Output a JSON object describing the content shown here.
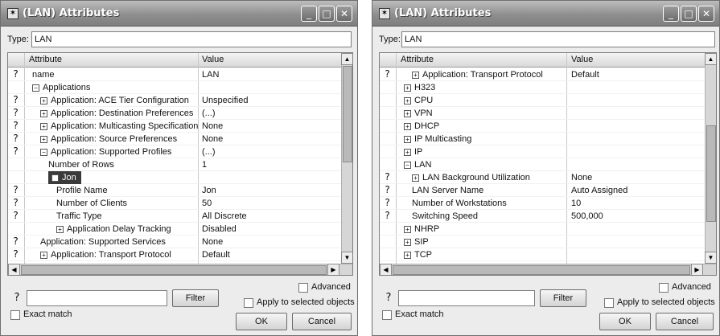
{
  "left": {
    "title": "(LAN) Attributes",
    "type_label": "Type:",
    "type_value": "LAN",
    "columns": {
      "attribute": "Attribute",
      "value": "Value"
    },
    "rows": [
      {
        "help": true,
        "indent": 1,
        "toggle": "",
        "label": "name",
        "value": "LAN"
      },
      {
        "help": false,
        "indent": 1,
        "toggle": "−",
        "label": "Applications",
        "value": ""
      },
      {
        "help": true,
        "indent": 2,
        "toggle": "+",
        "label": "Application: ACE Tier Configuration",
        "value": "Unspecified"
      },
      {
        "help": true,
        "indent": 2,
        "toggle": "+",
        "label": "Application: Destination Preferences",
        "value": "(...)"
      },
      {
        "help": true,
        "indent": 2,
        "toggle": "+",
        "label": "Application: Multicasting Specification",
        "value": "None"
      },
      {
        "help": true,
        "indent": 2,
        "toggle": "+",
        "label": "Application: Source Preferences",
        "value": "None"
      },
      {
        "help": true,
        "indent": 2,
        "toggle": "−",
        "label": "Application: Supported Profiles",
        "value": "(...)"
      },
      {
        "help": false,
        "indent": 3,
        "toggle": "",
        "label": "Number of Rows",
        "value": "1"
      },
      {
        "help": false,
        "indent": 3,
        "toggle": "−",
        "label": "Jon",
        "value": "",
        "selected": true
      },
      {
        "help": true,
        "indent": 4,
        "toggle": "",
        "label": "Profile Name",
        "value": "Jon"
      },
      {
        "help": true,
        "indent": 4,
        "toggle": "",
        "label": "Number of Clients",
        "value": "50"
      },
      {
        "help": true,
        "indent": 4,
        "toggle": "",
        "label": "Traffic Type",
        "value": "All Discrete"
      },
      {
        "help": false,
        "indent": 4,
        "toggle": "+",
        "label": "Application Delay Tracking",
        "value": "Disabled"
      },
      {
        "help": true,
        "indent": 2,
        "toggle": "",
        "label": "Application: Supported Services",
        "value": "None"
      },
      {
        "help": true,
        "indent": 2,
        "toggle": "+",
        "label": "Application: Transport Protocol",
        "value": "Default"
      }
    ],
    "filter_label": "Filter",
    "advanced_label": "Advanced",
    "apply_label": "Apply to selected objects",
    "exact_match_label": "Exact match",
    "ok_label": "OK",
    "cancel_label": "Cancel"
  },
  "right": {
    "title": "(LAN) Attributes",
    "type_label": "Type:",
    "type_value": "LAN",
    "columns": {
      "attribute": "Attribute",
      "value": "Value"
    },
    "rows": [
      {
        "help": true,
        "indent": 2,
        "toggle": "+",
        "label": "Application: Transport Protocol",
        "value": "Default"
      },
      {
        "help": false,
        "indent": 1,
        "toggle": "+",
        "label": "H323",
        "value": ""
      },
      {
        "help": false,
        "indent": 1,
        "toggle": "+",
        "label": "CPU",
        "value": ""
      },
      {
        "help": false,
        "indent": 1,
        "toggle": "+",
        "label": "VPN",
        "value": ""
      },
      {
        "help": false,
        "indent": 1,
        "toggle": "+",
        "label": "DHCP",
        "value": ""
      },
      {
        "help": false,
        "indent": 1,
        "toggle": "+",
        "label": "IP Multicasting",
        "value": ""
      },
      {
        "help": false,
        "indent": 1,
        "toggle": "+",
        "label": "IP",
        "value": ""
      },
      {
        "help": false,
        "indent": 1,
        "toggle": "−",
        "label": "LAN",
        "value": ""
      },
      {
        "help": true,
        "indent": 2,
        "toggle": "+",
        "label": "LAN Background Utilization",
        "value": "None"
      },
      {
        "help": true,
        "indent": 2,
        "toggle": "",
        "label": "LAN Server Name",
        "value": "Auto Assigned"
      },
      {
        "help": true,
        "indent": 2,
        "toggle": "",
        "label": "Number of Workstations",
        "value": "10"
      },
      {
        "help": true,
        "indent": 2,
        "toggle": "",
        "label": "Switching Speed",
        "value": "500,000"
      },
      {
        "help": false,
        "indent": 1,
        "toggle": "+",
        "label": "NHRP",
        "value": ""
      },
      {
        "help": false,
        "indent": 1,
        "toggle": "+",
        "label": "SIP",
        "value": ""
      },
      {
        "help": false,
        "indent": 1,
        "toggle": "+",
        "label": "TCP",
        "value": ""
      }
    ],
    "filter_label": "Filter",
    "advanced_label": "Advanced",
    "apply_label": "Apply to selected objects",
    "exact_match_label": "Exact match",
    "ok_label": "OK",
    "cancel_label": "Cancel"
  }
}
